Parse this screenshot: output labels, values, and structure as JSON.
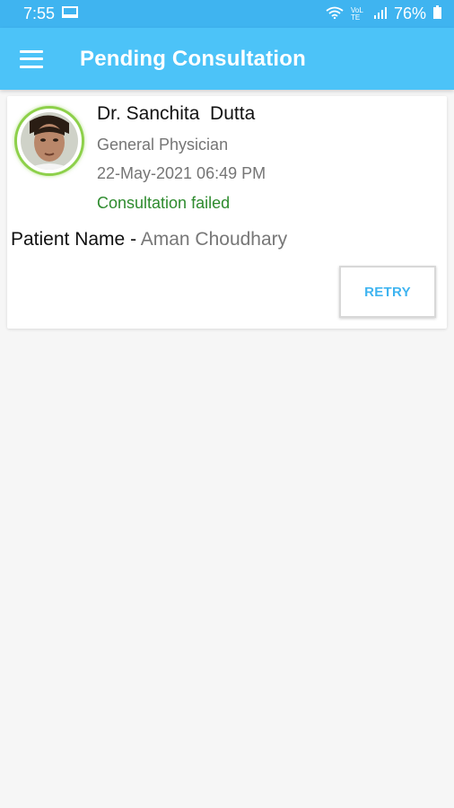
{
  "status_bar": {
    "time": "7:55",
    "battery": "76%",
    "network_label": "VoLTE",
    "icons": [
      "screen-cast-icon",
      "wifi-icon",
      "signal-icon",
      "battery-icon"
    ]
  },
  "app_bar": {
    "title": "Pending Consultation",
    "menu_icon": "hamburger-menu-icon"
  },
  "consultation": {
    "doctor_name": "Dr. Sanchita  Dutta",
    "specialization": "General Physician",
    "date_time": "22-May-2021 06:49 PM",
    "status": "Consultation failed",
    "patient_label": "Patient Name - ",
    "patient_name": "Aman Choudhary",
    "retry_label": "RETRY"
  },
  "colors": {
    "status_bar": "#3fb4f0",
    "app_bar": "#4cc3f8",
    "status_failed": "#2e8b2e",
    "retry_text": "#3fb4f0",
    "avatar_ring": "#8dd04a"
  }
}
